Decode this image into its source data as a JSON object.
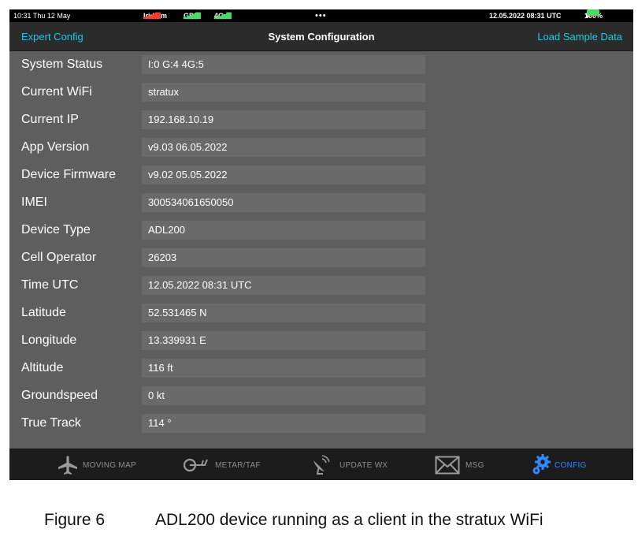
{
  "status_bar": {
    "time_date": "10:31  Thu 12 May",
    "iridium_label": "Iridium",
    "gps_label": "GPS",
    "cell_label": "4G",
    "dots": "•••",
    "datetime": "12.05.2022  08:31 UTC",
    "battery": "100%"
  },
  "nav": {
    "left": "Expert Config",
    "title": "System Configuration",
    "right": "Load Sample Data"
  },
  "rows": [
    {
      "label": "System Status",
      "value": "I:0 G:4 4G:5"
    },
    {
      "label": "Current WiFi",
      "value": "stratux"
    },
    {
      "label": "Current IP",
      "value": "192.168.10.19"
    },
    {
      "label": "App Version",
      "value": "v9.03 06.05.2022"
    },
    {
      "label": "Device Firmware",
      "value": "v9.02 05.05.2022"
    },
    {
      "label": "IMEI",
      "value": "300534061650050"
    },
    {
      "label": "Device Type",
      "value": "ADL200"
    },
    {
      "label": "Cell Operator",
      "value": "26203"
    },
    {
      "label": "Time UTC",
      "value": "12.05.2022  08:31 UTC"
    },
    {
      "label": "Latitude",
      "value": "52.531465 N"
    },
    {
      "label": "Longitude",
      "value": "13.339931 E"
    },
    {
      "label": "Altitude",
      "value": "116 ft"
    },
    {
      "label": "Groundspeed",
      "value": "0 kt"
    },
    {
      "label": "True Track",
      "value": "114 °"
    }
  ],
  "tabs": {
    "moving_map": {
      "label": "MOVING MAP",
      "icon": "airplane-icon"
    },
    "metar_taf": {
      "label": "METAR/TAF",
      "icon": "windsock-icon"
    },
    "update_wx": {
      "label": "UPDATE WX",
      "icon": "satellite-dish-icon"
    },
    "msg": {
      "label": "MSG",
      "icon": "envelope-icon"
    },
    "config": {
      "label": "CONFIG",
      "icon": "gear-icon",
      "active": true
    }
  },
  "caption": {
    "number": "Figure 6",
    "text": "ADL200 device running as a client in the stratux WiFi"
  },
  "colors": {
    "accent": "#2ec4dd",
    "active_tab": "#2f8cff",
    "background": "#5e5e5e",
    "field": "#6a6a6a"
  }
}
